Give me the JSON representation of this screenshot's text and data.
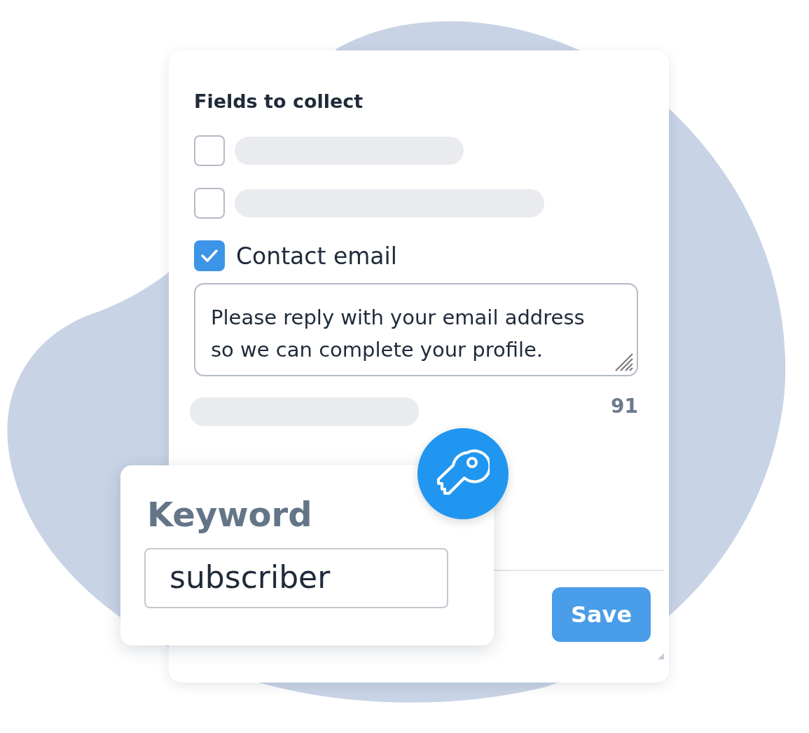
{
  "form": {
    "title": "Fields to collect",
    "fields": [
      {
        "kind": "placeholder",
        "checked": false
      },
      {
        "kind": "placeholder",
        "checked": false
      },
      {
        "kind": "labeled",
        "label": "Contact email",
        "checked": true
      }
    ],
    "message": {
      "value": "Please reply with your email address so we can complete your profile."
    },
    "counter": "91",
    "save_button": "Save"
  },
  "keyword": {
    "label": "Keyword",
    "value": "subscriber"
  }
}
